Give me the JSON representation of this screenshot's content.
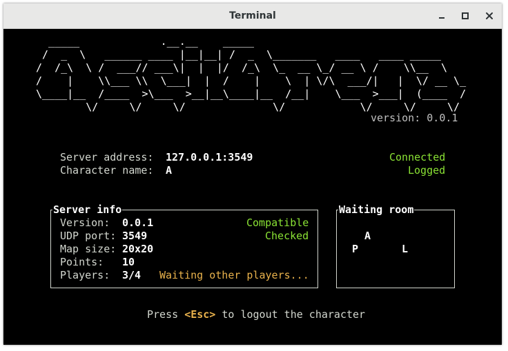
{
  "window": {
    "title": "Terminal",
    "controls": [
      "minimize-icon",
      "maximize-icon",
      "close-icon"
    ]
  },
  "banner": {
    "ascii_art": "  _____             .__.__    _____                              \n /  _  \\   ______ ____ |__|__| /  _  \\_______   ____   ____ _____  \n/  /_\\  \\ /  ___// ___\\|  |  |/  /_\\  \\_  __ \\_/ __ \\ /    \\\\__  \\ \n/    |    \\\\___ \\\\  \\___|  |  /    |    \\  | \\/\\  ___/|   |  \\/ __ \\_\n\\____|__  /____  >\\___  >__|__\\____|__  /__|    \\___  >___|  (____  /\n        \\/     \\/     \\/              \\/            \\/     \\/     \\/ ",
    "version_text": "version: 0.0.1"
  },
  "connection": {
    "server_address_label": "Server address:",
    "server_address_value": "127.0.0.1:3549",
    "character_name_label": "Character name:",
    "character_name_value": "A",
    "connection_status": "Connected",
    "login_status": "Logged"
  },
  "server_info": {
    "title": "Server info",
    "rows": [
      {
        "label": "Version:",
        "value": "0.0.1",
        "status": "Compatible"
      },
      {
        "label": "UDP port:",
        "value": "3549",
        "status": "Checked"
      },
      {
        "label": "Map size:",
        "value": "20x20",
        "status": ""
      },
      {
        "label": "Points:",
        "value": "10",
        "status": ""
      },
      {
        "label": "Players:",
        "value": "3/4",
        "status": "Waiting other players..."
      }
    ]
  },
  "waiting_room": {
    "title": "Waiting room",
    "players": [
      "A",
      "P",
      "L"
    ]
  },
  "footer": {
    "prefix": "Press ",
    "key": "<Esc>",
    "suffix": " to logout the character"
  },
  "colors": {
    "background": "#000000",
    "text": "#d3d7cf",
    "status_green": "#8ae234",
    "highlight_yellow": "#e9b24c",
    "titlebar": "#e8e8e7"
  }
}
